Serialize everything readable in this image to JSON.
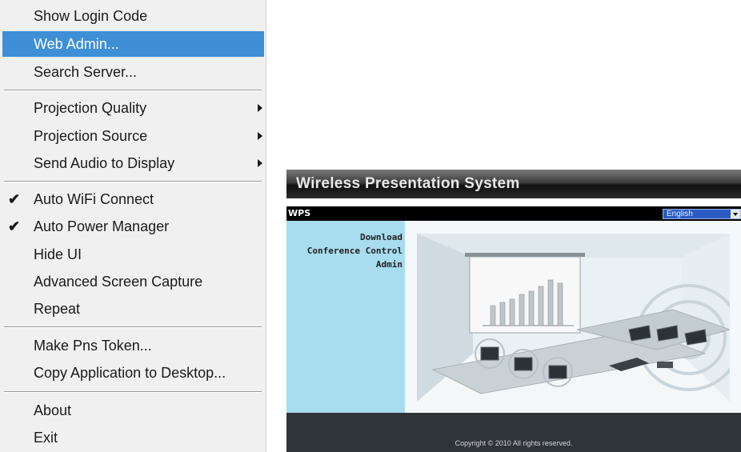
{
  "menu": {
    "items": [
      {
        "label": "Show Login Code"
      },
      {
        "label": "Web Admin..."
      },
      {
        "label": "Search Server..."
      },
      {
        "label": "Projection Quality"
      },
      {
        "label": "Projection Source"
      },
      {
        "label": "Send Audio to Display"
      },
      {
        "label": "Auto WiFi Connect"
      },
      {
        "label": "Auto Power Manager"
      },
      {
        "label": "Hide UI"
      },
      {
        "label": "Advanced Screen Capture"
      },
      {
        "label": "Repeat"
      },
      {
        "label": "Make Pns Token..."
      },
      {
        "label": "Copy Application to Desktop..."
      },
      {
        "label": "About"
      },
      {
        "label": "Exit"
      }
    ],
    "highlighted_item": "Web Admin...",
    "submenu_items": [
      "Projection Quality",
      "Projection Source",
      "Send Audio to Display"
    ],
    "checked_items": [
      "Auto WiFi Connect",
      "Auto Power Manager"
    ],
    "highlight_color": "#3e8fd6"
  },
  "web": {
    "title": "Wireless Presentation System",
    "brand": "WPS",
    "language_selected": "English",
    "nav": [
      {
        "label": "Download"
      },
      {
        "label": "Conference Control"
      },
      {
        "label": "Admin"
      }
    ],
    "copyright": "Copyright © 2010 All rights reserved.",
    "sidebar_color": "#a8dcef",
    "footer_color": "#2f3439"
  }
}
